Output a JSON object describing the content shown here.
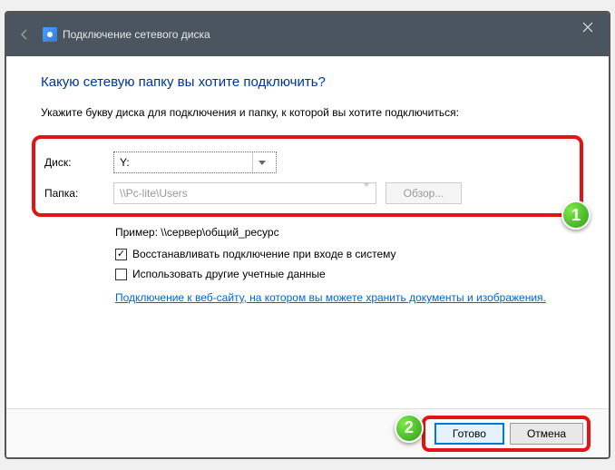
{
  "titlebar": {
    "title": "Подключение сетевого диска"
  },
  "content": {
    "heading": "Какую сетевую папку вы хотите подключить?",
    "subheading": "Укажите букву диска для подключения и папку, к которой вы хотите подключиться:",
    "drive_label": "Диск:",
    "drive_value": "Y:",
    "folder_label": "Папка:",
    "folder_value": "\\\\Pc-lite\\Users",
    "browse_label": "Обзор...",
    "example_text": "Пример: \\\\сервер\\общий_ресурс",
    "checkbox1_label": "Восстанавливать подключение при входе в систему",
    "checkbox2_label": "Использовать другие учетные данные",
    "link_text": "Подключение к веб-сайту, на котором вы можете хранить документы и изображения."
  },
  "footer": {
    "done_label": "Готово",
    "cancel_label": "Отмена"
  },
  "badges": {
    "one": "1",
    "two": "2"
  }
}
